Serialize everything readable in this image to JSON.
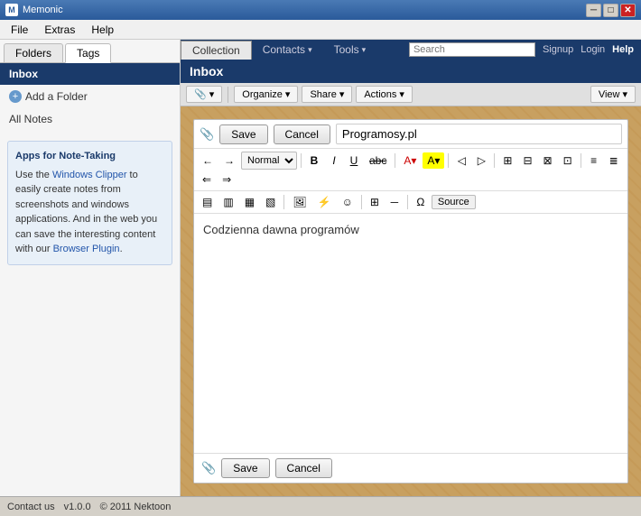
{
  "app": {
    "title": "Memonic",
    "name": "memonic"
  },
  "titlebar": {
    "buttons": {
      "minimize": "─",
      "maximize": "□",
      "close": "✕"
    }
  },
  "menubar": {
    "items": [
      "File",
      "Extras",
      "Help"
    ]
  },
  "topnav": {
    "tabs": [
      {
        "label": "Collection",
        "active": true
      },
      {
        "label": "Contacts",
        "has_arrow": true
      },
      {
        "label": "Tools",
        "has_arrow": true
      }
    ],
    "search_placeholder": "Search",
    "links": [
      "Signup",
      "Login",
      "Help"
    ]
  },
  "sidebar": {
    "tabs": [
      "Folders",
      "Tags"
    ],
    "active_tab": "Folders",
    "inbox_label": "Inbox",
    "add_folder_label": "Add a Folder",
    "all_notes_label": "All Notes",
    "info_box": {
      "title": "Apps for Note-Taking",
      "text": "Use the ",
      "link1": "Windows Clipper",
      "text2": " to easily create notes from screenshots and windows applications. And in the web you can save the interesting content with our ",
      "link2": "Browser Plugin",
      "text3": "."
    }
  },
  "content": {
    "inbox_label": "Inbox",
    "toolbar": {
      "organize_label": "Organize",
      "share_label": "Share",
      "actions_label": "Actions",
      "view_label": "View"
    },
    "editor": {
      "save_label": "Save",
      "cancel_label": "Cancel",
      "title_value": "Programosy.pl",
      "title_placeholder": "",
      "format_normal": "Normal",
      "body_text": "Codzienna dawna programów",
      "source_label": "Source"
    }
  },
  "statusbar": {
    "contact_us": "Contact us",
    "version": "v1.0.0",
    "copyright": "© 2011 Nektoon"
  }
}
